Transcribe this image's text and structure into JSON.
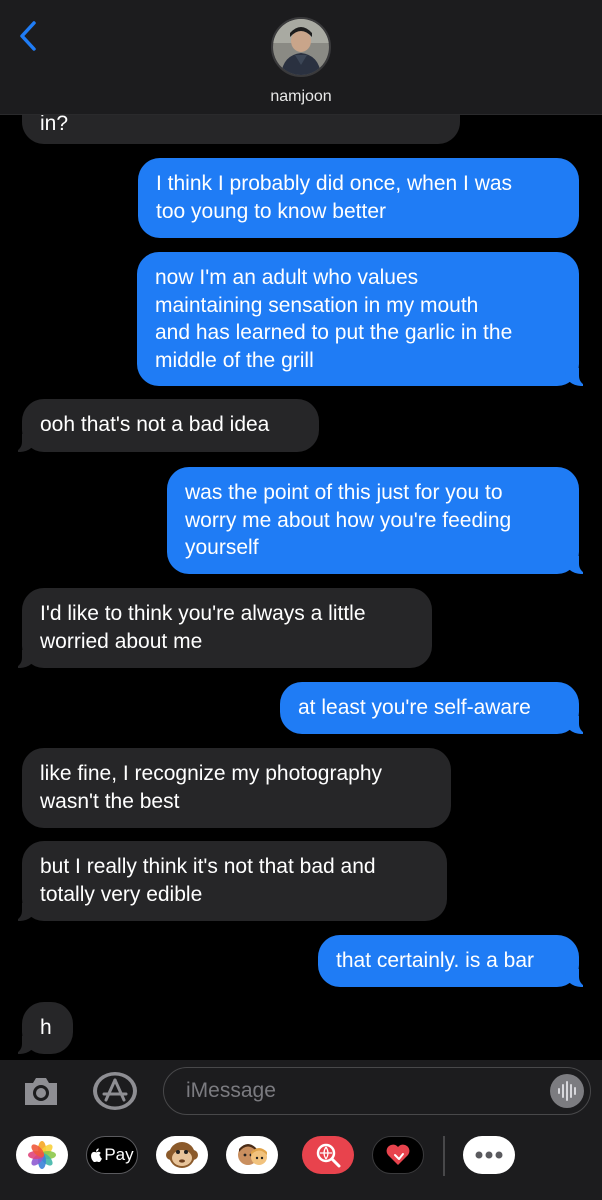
{
  "contact": {
    "name": "namjoon"
  },
  "messages": [
    {
      "dir": "in",
      "text": "in?"
    },
    {
      "dir": "out",
      "text": "I think I probably did once, when I was\ntoo young to know better"
    },
    {
      "dir": "out",
      "text": "now I'm an adult who values\nmaintaining sensation in my mouth\nand has learned to put the garlic in the\nmiddle of the grill"
    },
    {
      "dir": "in",
      "text": "ooh that's not a bad idea"
    },
    {
      "dir": "out",
      "text": "was the point of this just for you to\nworry me about how you're feeding\nyourself"
    },
    {
      "dir": "in",
      "text": "I'd like to think you're always a little\nworried about me"
    },
    {
      "dir": "out",
      "text": "at least you're self-aware"
    },
    {
      "dir": "in",
      "text": "like fine, I recognize my photography\nwasn't the best"
    },
    {
      "dir": "in",
      "text": "but I really think it's not that bad and\ntotally very edible"
    },
    {
      "dir": "out",
      "text": "that certainly. is a bar"
    },
    {
      "dir": "in",
      "text": "h"
    }
  ],
  "input": {
    "placeholder": "iMessage"
  },
  "drawer": {
    "apple_pay_label": "Pay",
    "apps": [
      "photos-icon",
      "apple-pay-icon",
      "monkey-memoji-icon",
      "memoji-icon",
      "web-search-icon",
      "digital-touch-icon",
      "more-icon"
    ]
  },
  "colors": {
    "outgoing": "#1f7cf5",
    "incoming": "#262628",
    "background": "#000000",
    "bar": "#1c1c1e"
  }
}
